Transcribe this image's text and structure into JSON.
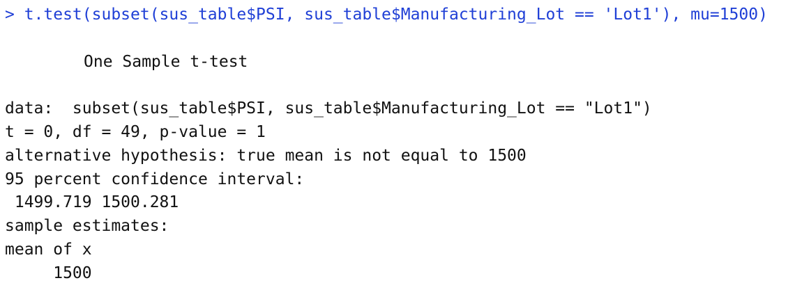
{
  "console": {
    "command": "> t.test(subset(sus_table$PSI, sus_table$Manufacturing_Lot == 'Lot1'), mu=1500)",
    "test_title": "One Sample t-test",
    "data_line": "data:  subset(sus_table$PSI, sus_table$Manufacturing_Lot == \"Lot1\")",
    "stats_line": "t = 0, df = 49, p-value = 1",
    "alt_hypothesis": "alternative hypothesis: true mean is not equal to 1500",
    "ci_label": "95 percent confidence interval:",
    "ci_values": " 1499.719 1500.281",
    "estimates_label": "sample estimates:",
    "estimate_name": "mean of x",
    "estimate_value": "     1500"
  },
  "colors": {
    "command_text": "#1f3fd6",
    "output_text": "#111111",
    "background": "#ffffff"
  }
}
